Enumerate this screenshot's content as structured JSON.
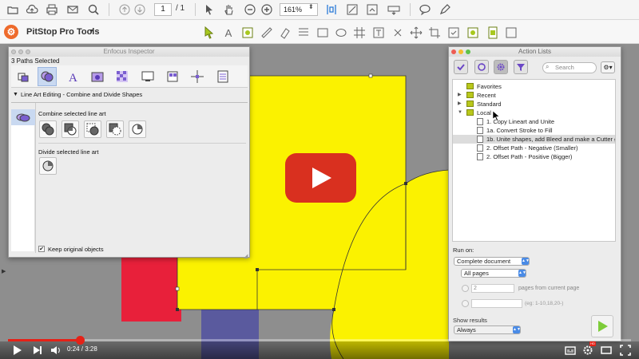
{
  "toolbar": {
    "page_current": "1",
    "page_total": "/ 1",
    "zoom": "161%"
  },
  "pitstop": {
    "title": "PitStop Pro Tools"
  },
  "inspector": {
    "title": "Enfocus Inspector",
    "selection_status": "3 Paths Selected",
    "section": "Line Art Editing - Combine and Divide Shapes",
    "combine_label": "Combine selected line art",
    "divide_label": "Divide selected line art",
    "keep_original_label": "Keep original objects",
    "keep_original_checked": "✔"
  },
  "action_lists": {
    "title": "Action Lists",
    "search_placeholder": "Search",
    "tree": [
      {
        "label": "Favorites"
      },
      {
        "label": "Recent"
      },
      {
        "label": "Standard"
      },
      {
        "label": "Local"
      },
      {
        "label": "1. Copy Lineart and Unite"
      },
      {
        "label": "1a. Convert Stroke to Fill"
      },
      {
        "label": "1b. Unite shapes, add Bleed and make a Cutter g..."
      },
      {
        "label": "2. Offset Path - Negative (Smaller)"
      },
      {
        "label": "2. Offset Path - Positive (Bigger)"
      }
    ],
    "run_on_label": "Run on:",
    "run_on_value": "Complete document",
    "pages_value": "All pages",
    "pages_count_value": "2",
    "pages_from_label": "pages from current page",
    "pages_example": "(eg: 1-10,18,20-)",
    "show_results_label": "Show results",
    "show_results_value": "Always"
  },
  "video": {
    "time": "0:24 / 3:28",
    "progress": 0.115,
    "hd_badge": "HD"
  },
  "colors": {
    "yellow": "#fbf200",
    "red": "#e8203a",
    "purple": "#5a5a9e",
    "pitstop_orange": "#ee6a2b",
    "youtube_red": "#e52117",
    "folder_green": "#b9c81b"
  }
}
